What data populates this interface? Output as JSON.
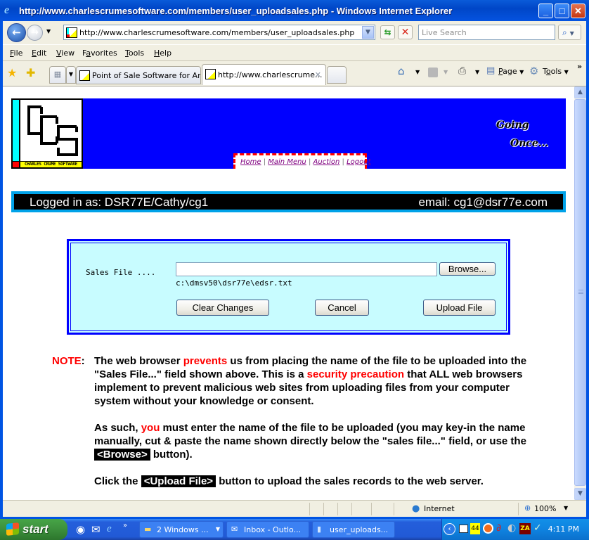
{
  "window": {
    "title": "http://www.charlescrumesoftware.com/members/user_uploadsales.php - Windows Internet Explorer",
    "minimize": "_",
    "maximize": "□",
    "close": "✕"
  },
  "navbar": {
    "back": "←",
    "forward": "→",
    "address": "http://www.charlescrumesoftware.com/members/user_uploadsales.php",
    "refresh": "⇆",
    "stop": "✕",
    "search_placeholder": "Live Search",
    "search_icon": "⌕"
  },
  "menu": {
    "items": [
      {
        "label": "File",
        "key": "F"
      },
      {
        "label": "Edit",
        "key": "E"
      },
      {
        "label": "View",
        "key": "V"
      },
      {
        "label": "Favorites",
        "key": "a"
      },
      {
        "label": "Tools",
        "key": "T"
      },
      {
        "label": "Help",
        "key": "H"
      }
    ],
    "file": "File",
    "edit": "Edit",
    "view": "View",
    "favorites": "Favorites",
    "tools": "Tools",
    "help": "Help"
  },
  "tabs": {
    "items": [
      {
        "label": "Point of Sale Software for An...",
        "active": false
      },
      {
        "label": "http://www.charlescrume...",
        "active": true
      }
    ],
    "tab1": "Point of Sale Software for An...",
    "tab2": "http://www.charlescrume...",
    "close": "✕"
  },
  "commandbar": {
    "home": "⌂",
    "page": "Page",
    "tools": "Tools",
    "more": "»"
  },
  "page": {
    "logo_text": "CHARLES CRUME SOFTWARE",
    "nav_links": [
      "Home",
      "Main Menu",
      "Auction",
      "Logout"
    ],
    "nav_sep": " | ",
    "going_line1": "Going",
    "going_line2": "Once...",
    "logged_in": "Logged in as: DSR77E/Cathy/cg1",
    "email": "email: cg1@dsr77e.com",
    "form": {
      "label": "Sales File ....",
      "file_value": "",
      "browse": "Browse...",
      "hint": "c:\\dmsv50\\dsr77e\\edsr.txt",
      "clear": "Clear Changes",
      "cancel": "Cancel",
      "upload": "Upload File"
    },
    "note": {
      "label": "NOTE",
      "colon": ":",
      "p1_a": "The web browser ",
      "p1_red1": "prevents",
      "p1_b": " us from placing the name of the file to be uploaded into the \"Sales File...\" field shown above. This is a ",
      "p1_red2": "security precaution",
      "p1_c": " that ALL web browsers implement to prevent malicious web sites from uploading files from your computer system without your knowledge or consent.",
      "p2_a": "As such, ",
      "p2_red": "you",
      "p2_b": " must enter the name of the file to be uploaded (you may key-in the name manually, cut & paste the name shown directly below the \"sales file...\" field, or use the ",
      "p2_btn": "<Browse>",
      "p2_c": " button).",
      "p3_a": "Click the ",
      "p3_btn": "<Upload File>",
      "p3_b": " button to upload the sales records to the web server."
    }
  },
  "statusbar": {
    "zone": "Internet",
    "zoom": "100%"
  },
  "taskbar": {
    "start": "start",
    "buttons": [
      {
        "label": "2 Windows ...",
        "count": "2"
      },
      {
        "label": "Inbox - Outlo..."
      },
      {
        "label": "user_uploads..."
      }
    ],
    "btn1": "2 Windows ...",
    "btn2": "Inbox - Outlo...",
    "btn3": "user_uploads...",
    "tray_badge": "44",
    "tray_za": "ZA",
    "clock": "4:11 PM"
  },
  "colors": {
    "header_blue": "#0000ff",
    "form_bg": "#c8fcff",
    "accent_red": "#ff0000",
    "login_border": "#00a2e8"
  }
}
